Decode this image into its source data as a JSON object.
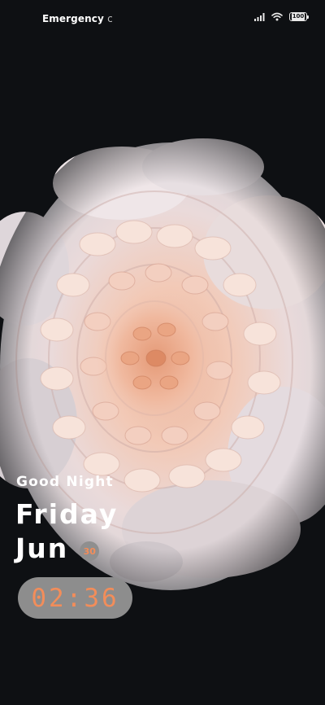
{
  "status_bar": {
    "carrier_text": "Emergency",
    "carrier_cut": "c",
    "battery_level": "100",
    "icons": [
      "signal-icon",
      "wifi-icon",
      "battery-icon"
    ]
  },
  "lockscreen": {
    "greeting": "Good Night",
    "day": "Friday",
    "month": "Jun",
    "date": "30",
    "time": "02:36"
  },
  "colors": {
    "background": "#0e1013",
    "accent": "#f28d5a",
    "pill": "#8d8d8d"
  }
}
